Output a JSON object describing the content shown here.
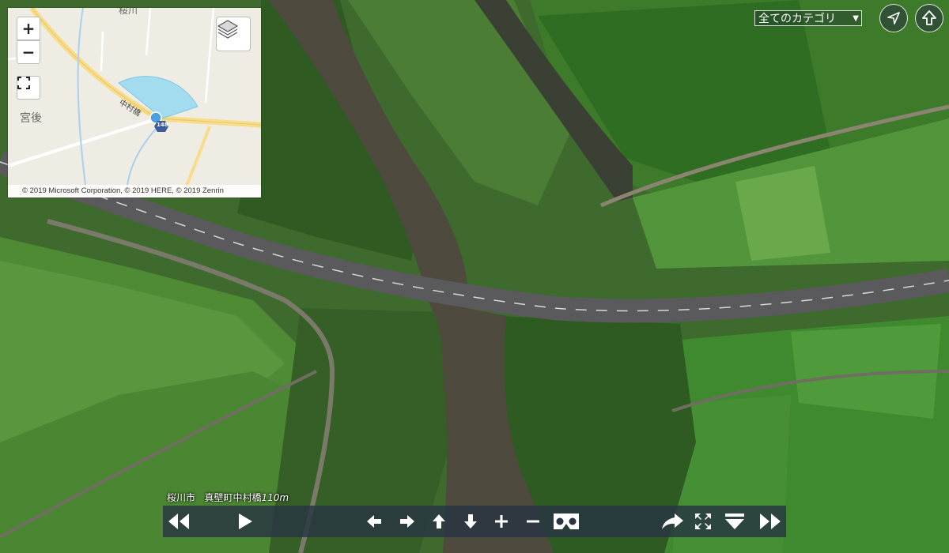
{
  "minimap": {
    "zoom_in": "+",
    "zoom_out": "−",
    "place_label": "宮後",
    "town_label": "桜川",
    "bridge_label": "中村橋",
    "route_badge": "148",
    "attribution": "© 2019 Microsoft Corporation, © 2019 HERE, © 2019 Zenrin"
  },
  "category_select": {
    "value": "全てのカテゴリ",
    "arrow": "▼"
  },
  "location": {
    "city": "桜川市",
    "place": "真壁町中村橋",
    "altitude": "110m"
  },
  "icons": {
    "locate": "navigation-arrow-icon",
    "up": "up-arrow-icon"
  },
  "colors": {
    "toolbar_bg": "#283442",
    "minimap_bg": "#efece4",
    "view_cone": "#8ed8f0",
    "position_dot": "#4a9fe0",
    "road": "#f7dc8a",
    "water": "#a8d0f0"
  }
}
